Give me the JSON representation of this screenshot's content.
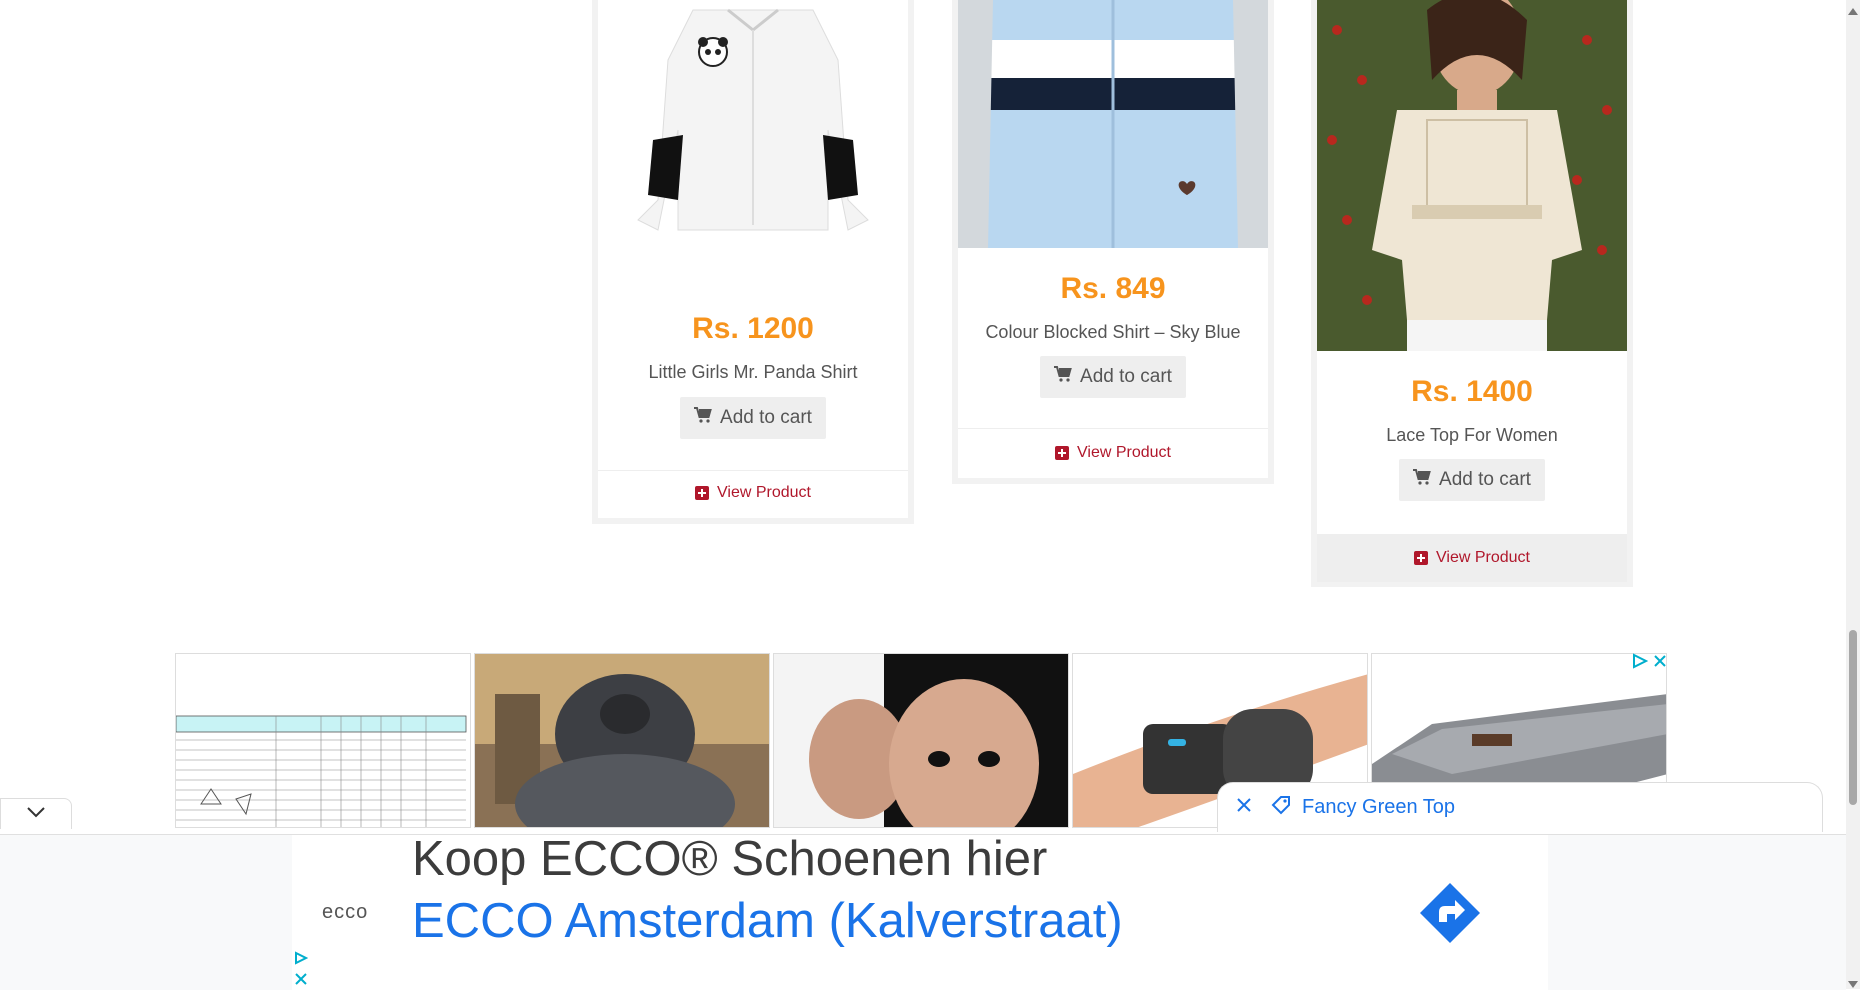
{
  "products": [
    {
      "price": "Rs. 1200",
      "name": "Little Girls Mr. Panda Shirt",
      "add_to_cart": "Add to cart",
      "view_product": "View Product"
    },
    {
      "price": "Rs. 849",
      "name": "Colour Blocked Shirt – Sky Blue",
      "add_to_cart": "Add to cart",
      "view_product": "View Product"
    },
    {
      "price": "Rs. 1400",
      "name": "Lace Top For Women",
      "add_to_cart": "Add to cart",
      "view_product": "View Product"
    }
  ],
  "suggestion": {
    "label": "Fancy Green Top"
  },
  "bottom_ad": {
    "brand_logo": "ecco",
    "headline": "Koop ECCO® Schoenen hier",
    "subline": "ECCO Amsterdam (Kalverstraat)"
  },
  "colors": {
    "price": "#f7941d",
    "view_link": "#b0172b",
    "ad_blue": "#1a73e8"
  },
  "icons": [
    "cart-icon",
    "plus-square-icon",
    "adchoices-icon",
    "close-icon",
    "tag-icon",
    "chevron-down-icon",
    "directions-arrow-icon"
  ]
}
